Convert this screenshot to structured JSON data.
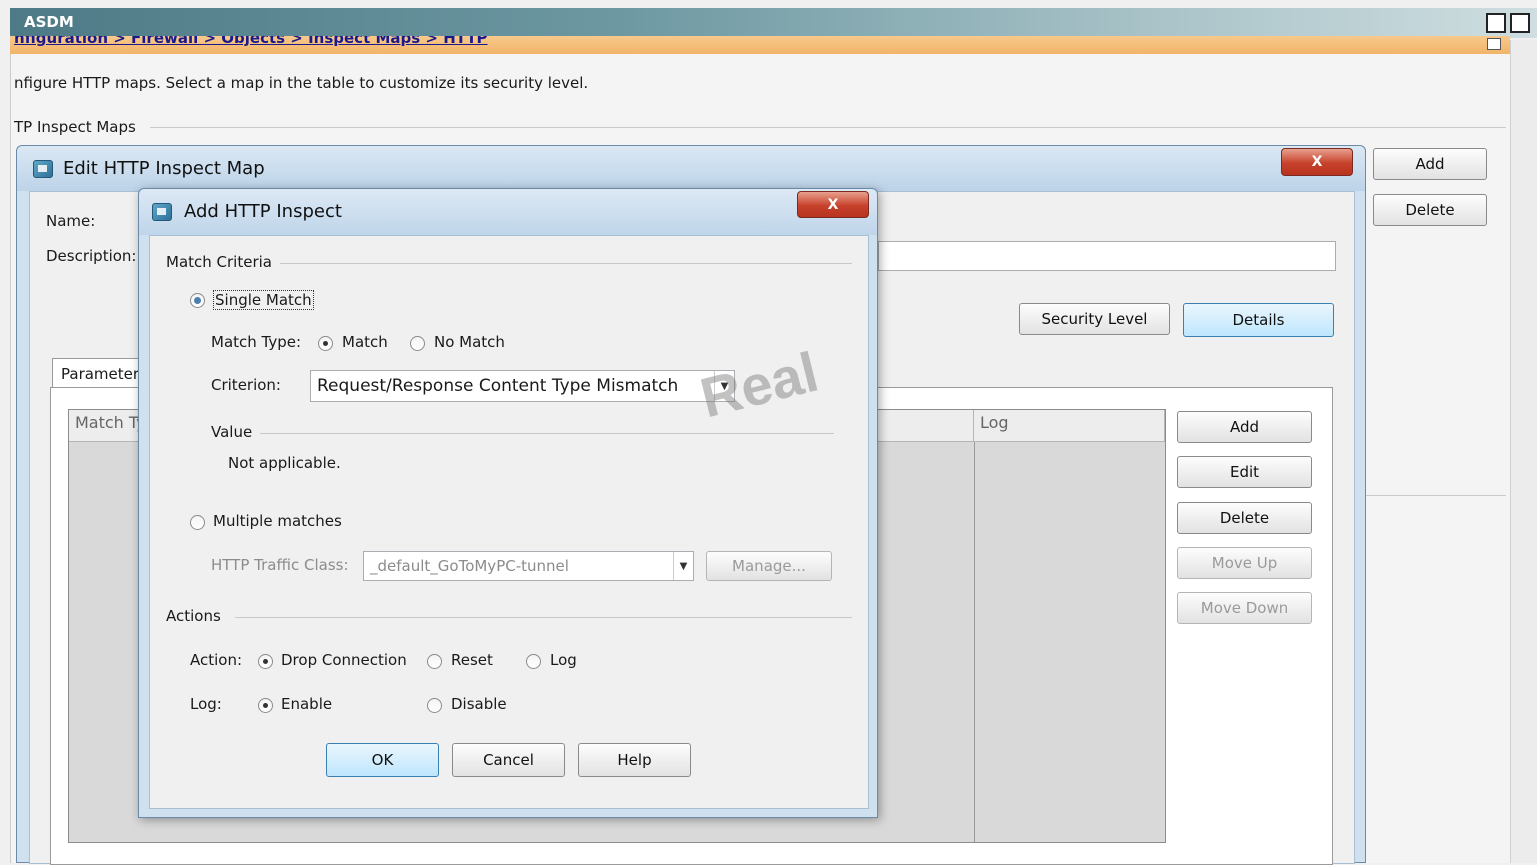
{
  "app": {
    "title": "ASDM",
    "breadcrumb": "nfiguration > Firewall > Objects > Inspect Maps > HTTP",
    "intro": "nfigure HTTP maps. Select a map in the table to customize its security level.",
    "section_label": "TP Inspect Maps",
    "right_buttons": {
      "add": "Add",
      "delete": "Delete"
    }
  },
  "edit_dialog": {
    "title": "Edit HTTP Inspect Map",
    "close_label": "X",
    "name_label": "Name:",
    "description_label": "Description:",
    "description_value": "",
    "security_level_button": "Security Level",
    "details_button": "Details",
    "tab_label": "Parameters",
    "table_columns": {
      "match": "Match Type",
      "log": "Log"
    },
    "side_buttons": {
      "add": "Add",
      "edit": "Edit",
      "delete": "Delete",
      "move_up": "Move Up",
      "move_down": "Move Down"
    }
  },
  "add_dialog": {
    "title": "Add HTTP Inspect",
    "close_label": "X",
    "match_criteria_group": "Match Criteria",
    "single_match": "Single Match",
    "match_type_label": "Match Type:",
    "match_option": "Match",
    "no_match_option": "No Match",
    "criterion_label": "Criterion:",
    "criterion_value": "Request/Response Content Type Mismatch",
    "value_group": "Value",
    "value_text": "Not applicable.",
    "multiple_matches": "Multiple matches",
    "traffic_class_label": "HTTP Traffic Class:",
    "traffic_class_value": "_default_GoToMyPC-tunnel",
    "manage_button": "Manage...",
    "actions_group": "Actions",
    "action_label": "Action:",
    "action_drop": "Drop Connection",
    "action_reset": "Reset",
    "action_log": "Log",
    "log_label": "Log:",
    "log_enable": "Enable",
    "log_disable": "Disable",
    "ok_button": "OK",
    "cancel_button": "Cancel",
    "help_button": "Help",
    "selected": {
      "match_mode": "Single Match",
      "match_type": "Match",
      "action": "Drop Connection",
      "log": "Enable"
    }
  },
  "watermark": "Real"
}
